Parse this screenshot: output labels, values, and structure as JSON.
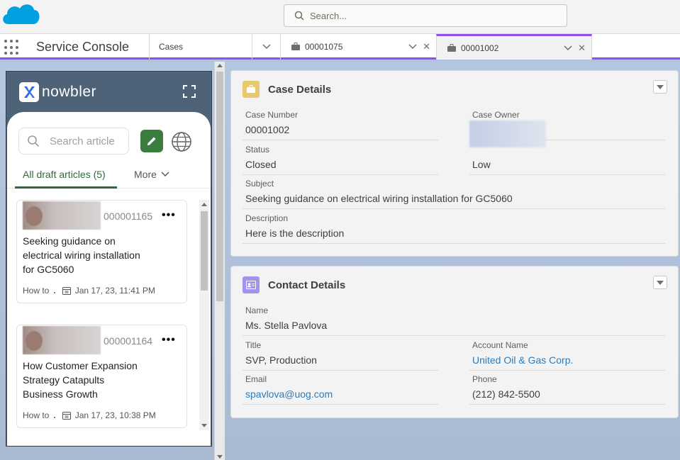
{
  "header": {
    "search_placeholder": "Search..."
  },
  "tabbar": {
    "app_name": "Service Console",
    "tabs": [
      {
        "label": "Cases"
      },
      {
        "label": "00001075"
      },
      {
        "label": "00001002"
      }
    ],
    "close_glyph": "✕"
  },
  "knowbler": {
    "brand": "nowbler",
    "search_placeholder": "Search article",
    "tabs": {
      "active": "All draft articles (5)",
      "more": "More"
    },
    "articles": [
      {
        "number": "000001165",
        "title": "Seeking guidance on electrical wiring installation for GC5060",
        "type": "How to",
        "date": "Jan 17, 23, 11:41 PM"
      },
      {
        "number": "000001164",
        "title": "How Customer Expansion Strategy Catapults Business Growth",
        "type": "How to",
        "date": "Jan 17, 23, 10:38 PM"
      }
    ],
    "more_glyph": "•••"
  },
  "case_details": {
    "title": "Case Details",
    "fields": {
      "case_number_label": "Case Number",
      "case_number": "00001002",
      "case_owner_label": "Case Owner",
      "status_label": "Status",
      "status": "Closed",
      "priority": "Low",
      "subject_label": "Subject",
      "subject": "Seeking guidance on electrical wiring installation for GC5060",
      "description_label": "Description",
      "description": "Here is the description"
    }
  },
  "contact_details": {
    "title": "Contact Details",
    "fields": {
      "name_label": "Name",
      "name": "Ms. Stella Pavlova",
      "title_label": "Title",
      "title": "SVP, Production",
      "account_label": "Account Name",
      "account": "United Oil & Gas Corp.",
      "email_label": "Email",
      "email": "spavlova@uog.com",
      "phone_label": "Phone",
      "phone": "(212) 842-5500"
    }
  },
  "colors": {
    "accent": "#9050e9",
    "brand_green": "#3a7d3f",
    "link": "#2e7bb8"
  }
}
